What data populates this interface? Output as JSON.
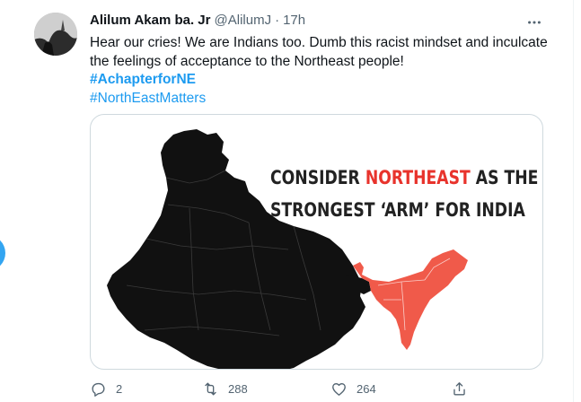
{
  "tweet": {
    "display_name": "Alilum Akam ba. Jr",
    "handle": "@AlilumJ",
    "separator": "·",
    "time": "17h",
    "text_line1": "Hear our cries! We are Indians too. Dumb this racist mindset and inculcate",
    "text_line2": "the feelings of acceptance to the Northeast people!",
    "hashtag1": "#AchapterforNE",
    "hashtag2": "#NorthEastMatters"
  },
  "card": {
    "title_part1": "CONSIDER ",
    "title_accent": "NORTHEAST",
    "title_part2": " AS THE",
    "title_line2": "STRONGEST ‘ARM’ FOR INDIA",
    "accent_color": "#e8332c",
    "map_color": "#111111"
  },
  "actions": {
    "reply_count": "2",
    "retweet_count": "288",
    "like_count": "264"
  },
  "colors": {
    "link": "#1d9bf0",
    "muted": "#536471",
    "text": "#0f1419",
    "border": "#cfd9de"
  },
  "icons": {
    "avatar": "avatar",
    "more": "more-icon",
    "reply": "reply-icon",
    "retweet": "retweet-icon",
    "like": "heart-icon",
    "share": "share-icon"
  }
}
